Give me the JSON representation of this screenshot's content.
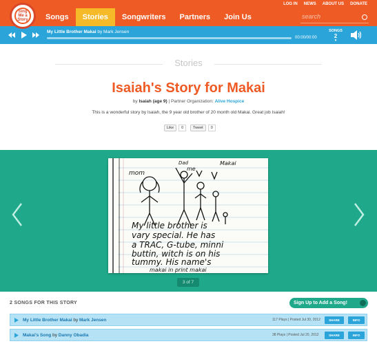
{
  "header": {
    "logo_text": "Sing Me a Story",
    "nav": [
      "Songs",
      "Stories",
      "Songwriters",
      "Partners",
      "Join Us"
    ],
    "active_nav": "Stories",
    "top_links": [
      "LOG IN",
      "NEWS",
      "ABOUT US",
      "DONATE"
    ],
    "search_placeholder": "search"
  },
  "player": {
    "song": "My Little Brother Makai",
    "by": "by Mark Jensen",
    "time": "00:00/00:00",
    "songs_label": "SONGS",
    "songs_count": "2"
  },
  "page": {
    "section": "Stories",
    "title": "Isaiah's Story for Makai",
    "by_prefix": "by",
    "author": "Isaiah (age 9)",
    "partner_prefix": "| Partner Organization:",
    "partner": "Alive Hospice",
    "description": "This is a wonderful story by Isaiah, the 9 year old brother of 20 month old Makai. Great job Isaiah!",
    "like_label": "Like",
    "like_count": "0",
    "tweet_label": "Tweet",
    "tweet_count": "0"
  },
  "gallery": {
    "counter": "3 of 7",
    "drawing_text": [
      "mom",
      "Dad",
      "me",
      "Makai",
      "My little brother is",
      "vary special. He has",
      "a TRAC, G-tube, minni",
      "buttin, witch is on his",
      "tummy. His name's",
      "makai in print makai"
    ]
  },
  "songs": {
    "heading": "2 SONGS FOR THIS STORY",
    "signup": "Sign Up to Add a Song!",
    "share_label": "SHARE",
    "info_label": "INFO",
    "items": [
      {
        "title": "My Little Brother Makai",
        "by": "by",
        "artist": "Mark Jensen",
        "meta": "117 Plays | Posted Jul 30, 2012"
      },
      {
        "title": "Makai's Song",
        "by": "by",
        "artist": "Danny Obadia",
        "meta": "38 Plays | Posted Jul 20, 2012"
      }
    ]
  }
}
